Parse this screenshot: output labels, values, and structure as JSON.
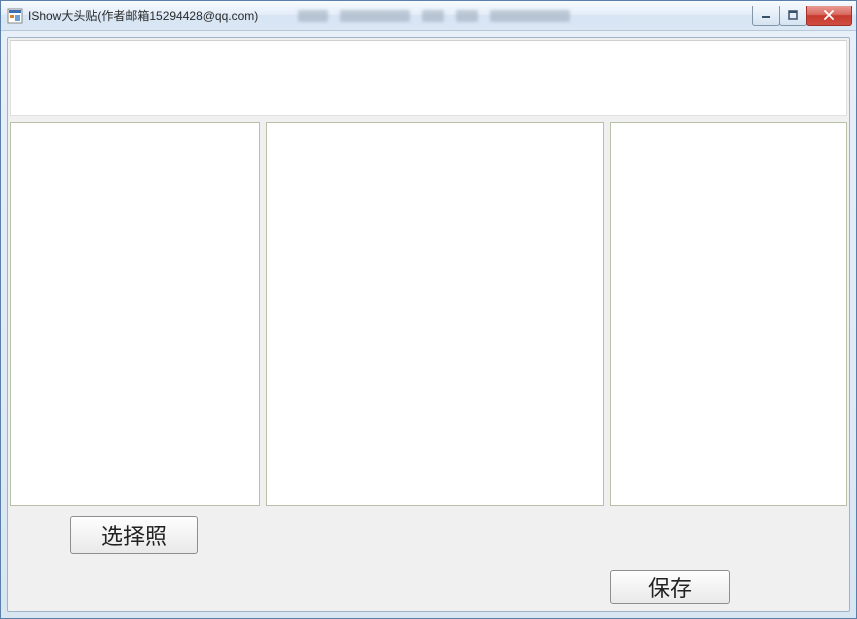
{
  "window": {
    "title": "IShow大头贴(作者邮箱15294428@qq.com)"
  },
  "buttons": {
    "select_photo": "选择照",
    "save": "保存"
  },
  "window_controls": {
    "minimize": "minimize",
    "maximize": "maximize",
    "close": "close"
  }
}
